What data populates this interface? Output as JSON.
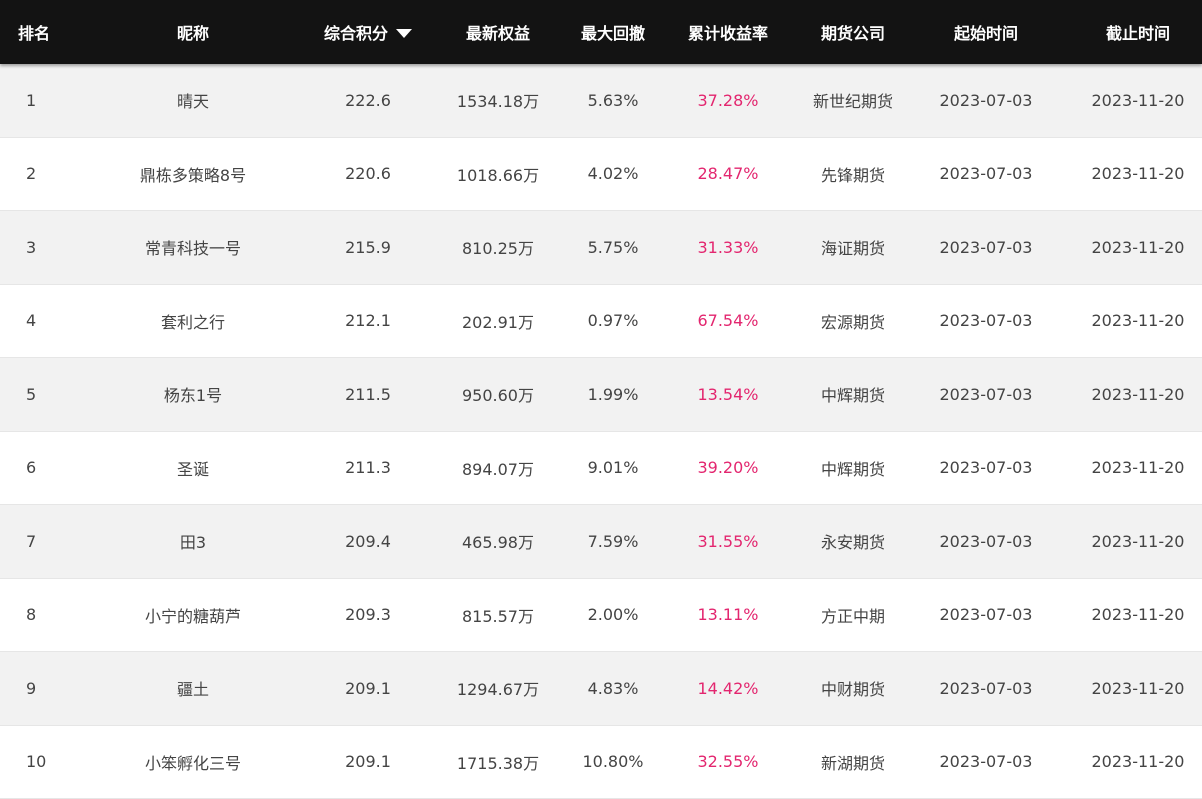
{
  "table": {
    "columns": {
      "rank": "排名",
      "nickname": "昵称",
      "score": "综合积分",
      "equity": "最新权益",
      "drawdown": "最大回撤",
      "return": "累计收益率",
      "company": "期货公司",
      "start": "起始时间",
      "end": "截止时间"
    },
    "sort_icon": "caret-down-icon",
    "rows": [
      {
        "rank": "1",
        "nickname": "晴天",
        "score": "222.6",
        "equity": "1534.18万",
        "drawdown": "5.63%",
        "return": "37.28%",
        "company": "新世纪期货",
        "start": "2023-07-03",
        "end": "2023-11-20"
      },
      {
        "rank": "2",
        "nickname": "鼎栋多策略8号",
        "score": "220.6",
        "equity": "1018.66万",
        "drawdown": "4.02%",
        "return": "28.47%",
        "company": "先锋期货",
        "start": "2023-07-03",
        "end": "2023-11-20"
      },
      {
        "rank": "3",
        "nickname": "常青科技一号",
        "score": "215.9",
        "equity": "810.25万",
        "drawdown": "5.75%",
        "return": "31.33%",
        "company": "海证期货",
        "start": "2023-07-03",
        "end": "2023-11-20"
      },
      {
        "rank": "4",
        "nickname": "套利之行",
        "score": "212.1",
        "equity": "202.91万",
        "drawdown": "0.97%",
        "return": "67.54%",
        "company": "宏源期货",
        "start": "2023-07-03",
        "end": "2023-11-20"
      },
      {
        "rank": "5",
        "nickname": "杨东1号",
        "score": "211.5",
        "equity": "950.60万",
        "drawdown": "1.99%",
        "return": "13.54%",
        "company": "中辉期货",
        "start": "2023-07-03",
        "end": "2023-11-20"
      },
      {
        "rank": "6",
        "nickname": "圣诞",
        "score": "211.3",
        "equity": "894.07万",
        "drawdown": "9.01%",
        "return": "39.20%",
        "company": "中辉期货",
        "start": "2023-07-03",
        "end": "2023-11-20"
      },
      {
        "rank": "7",
        "nickname": "田3",
        "score": "209.4",
        "equity": "465.98万",
        "drawdown": "7.59%",
        "return": "31.55%",
        "company": "永安期货",
        "start": "2023-07-03",
        "end": "2023-11-20"
      },
      {
        "rank": "8",
        "nickname": "小宁的糖葫芦",
        "score": "209.3",
        "equity": "815.57万",
        "drawdown": "2.00%",
        "return": "13.11%",
        "company": "方正中期",
        "start": "2023-07-03",
        "end": "2023-11-20"
      },
      {
        "rank": "9",
        "nickname": "疆土",
        "score": "209.1",
        "equity": "1294.67万",
        "drawdown": "4.83%",
        "return": "14.42%",
        "company": "中财期货",
        "start": "2023-07-03",
        "end": "2023-11-20"
      },
      {
        "rank": "10",
        "nickname": "小笨孵化三号",
        "score": "209.1",
        "equity": "1715.38万",
        "drawdown": "10.80%",
        "return": "32.55%",
        "company": "新湖期货",
        "start": "2023-07-03",
        "end": "2023-11-20"
      }
    ]
  },
  "colors": {
    "header_bg": "#131313",
    "row_alt_bg": "#f2f2f2",
    "return_color": "#e3266f"
  }
}
